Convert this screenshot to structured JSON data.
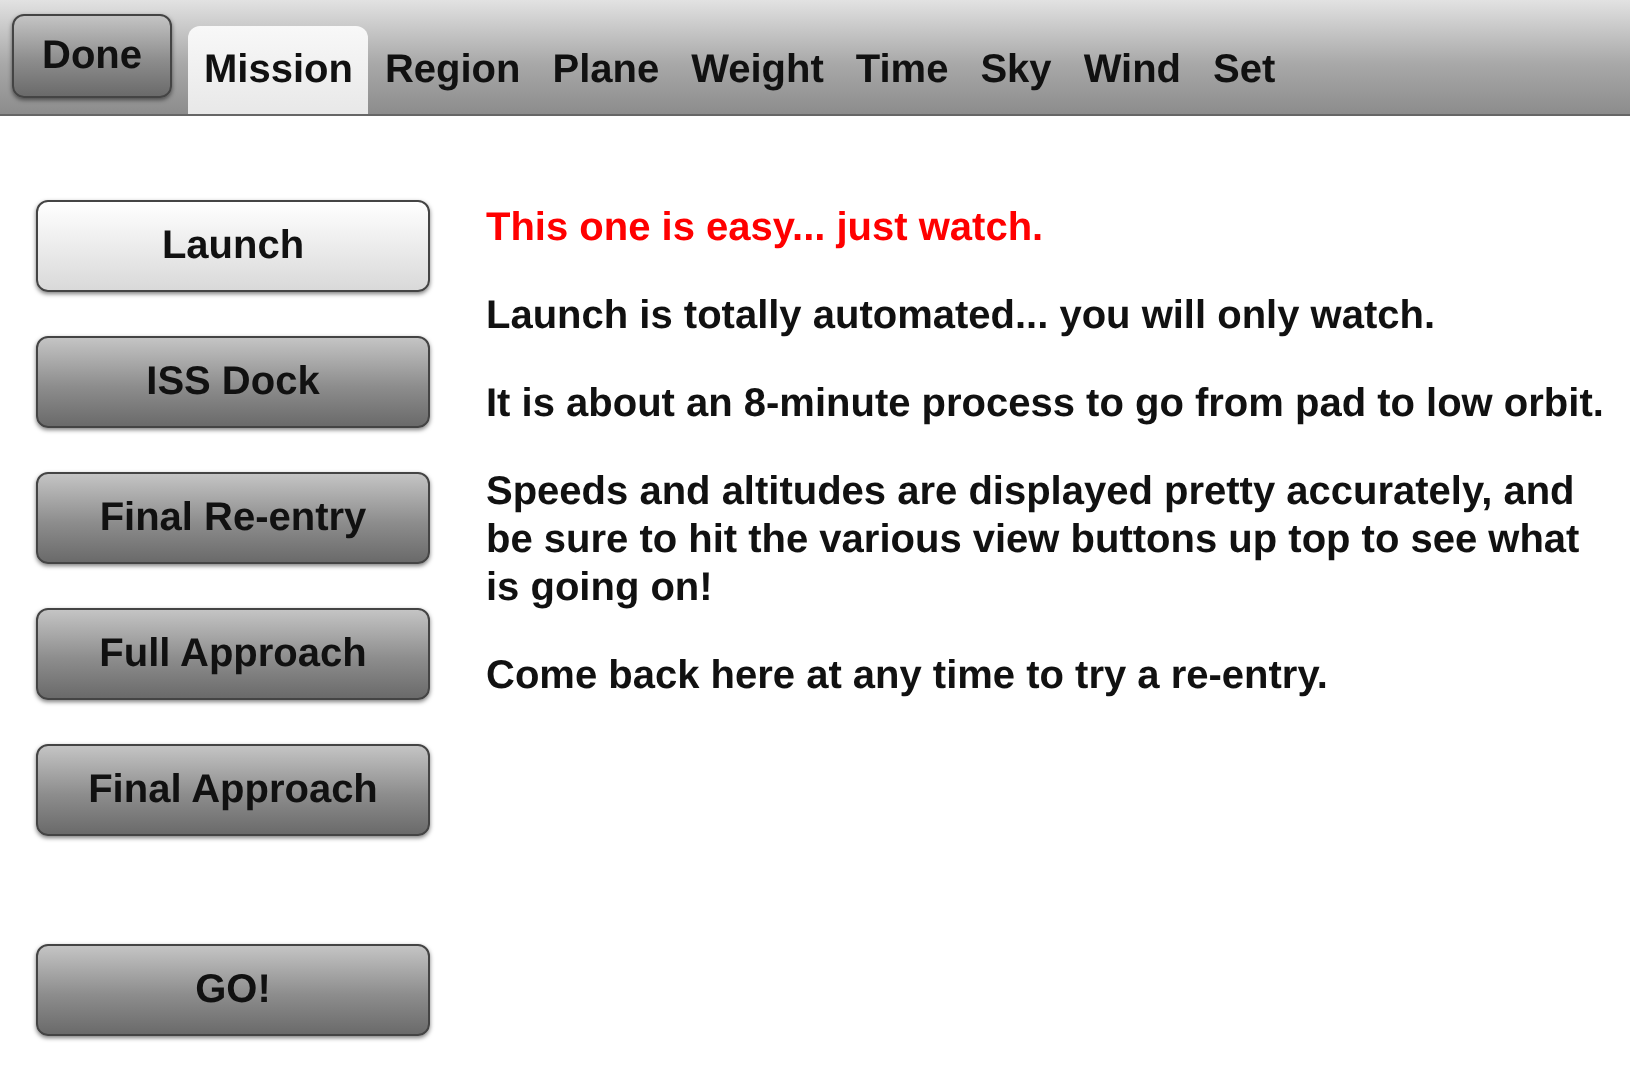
{
  "toolbar": [
    {
      "label": "Done",
      "kind": "button",
      "selected": false
    },
    {
      "label": "Mission",
      "kind": "tab",
      "selected": true
    },
    {
      "label": "Region",
      "kind": "tab",
      "selected": false
    },
    {
      "label": "Plane",
      "kind": "tab",
      "selected": false
    },
    {
      "label": "Weight",
      "kind": "tab",
      "selected": false
    },
    {
      "label": "Time",
      "kind": "tab",
      "selected": false
    },
    {
      "label": "Sky",
      "kind": "tab",
      "selected": false
    },
    {
      "label": "Wind",
      "kind": "tab",
      "selected": false
    },
    {
      "label": "Set",
      "kind": "tab",
      "selected": false
    }
  ],
  "missions": [
    {
      "label": "Launch",
      "selected": true
    },
    {
      "label": "ISS Dock",
      "selected": false
    },
    {
      "label": "Final Re-entry",
      "selected": false
    },
    {
      "label": "Full Approach",
      "selected": false
    },
    {
      "label": "Final Approach",
      "selected": false
    }
  ],
  "go_button": "GO!",
  "description": {
    "headline": "This one is easy... just watch.",
    "paragraphs": [
      "Launch is totally automated... you will only watch.",
      "It is about an 8-minute process to go from pad to low orbit.",
      "Speeds and altitudes are displayed pretty accurately, and be sure to hit the various view buttons up top to see what is going on!",
      "Come back here at any time to try a re-entry."
    ]
  }
}
